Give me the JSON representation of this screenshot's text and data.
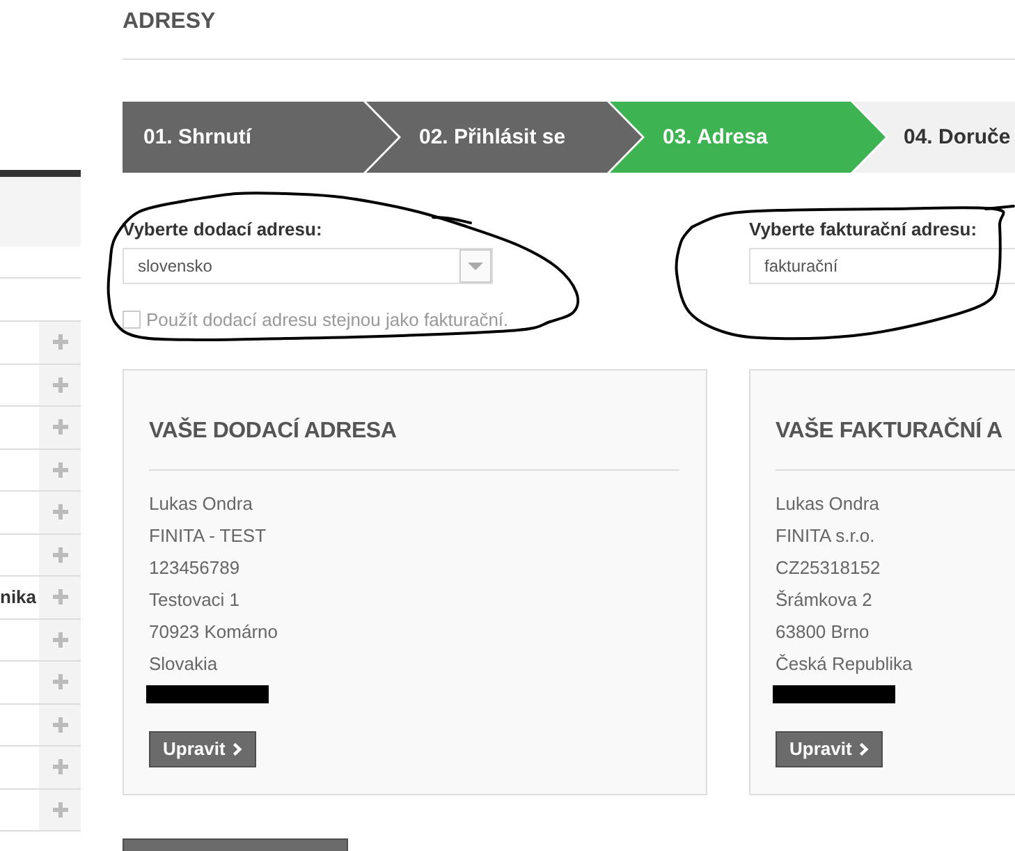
{
  "page": {
    "title": "ADRESY"
  },
  "sidebar": {
    "items": [
      {
        "expanded": false
      },
      {
        "expanded": false
      },
      {
        "expanded": false
      },
      {
        "expanded": false
      },
      {
        "expanded": false
      },
      {
        "expanded": false
      },
      {
        "label": "nika",
        "expanded": false
      },
      {
        "expanded": false
      },
      {
        "expanded": false
      },
      {
        "expanded": false
      },
      {
        "expanded": false
      },
      {
        "expanded": false
      }
    ]
  },
  "steps": [
    {
      "label": "01. Shrnutí",
      "completed": true,
      "selected": false
    },
    {
      "label": "02. Přihlásit se",
      "completed": true,
      "selected": false
    },
    {
      "label": "03. Adresa",
      "completed": false,
      "selected": true
    },
    {
      "label": "04. Doruče",
      "completed": false,
      "selected": false
    }
  ],
  "delivery_select": {
    "label": "Vyberte dodací adresu:",
    "value": "slovensko"
  },
  "same_address_checkbox": {
    "label": "Použít dodací adresu stejnou jako fakturační.",
    "checked": false
  },
  "billing_select": {
    "label": "Vyberte fakturační adresu:",
    "value": "fakturační"
  },
  "address_cards": [
    {
      "title": "VAŠE DODACÍ ADRESA",
      "lines": [
        "Lukas Ondra",
        "FINITA - TEST",
        "123456789",
        "Testovaci 1",
        "70923 Komárno",
        "Slovakia"
      ],
      "redacted": true,
      "button": "Upravit"
    },
    {
      "title": "VAŠE FAKTURAČNÍ A",
      "lines": [
        "Lukas Ondra",
        "FINITA s.r.o.",
        "CZ25318152",
        "Šrámkova 2",
        "63800 Brno",
        "Česká Republika"
      ],
      "redacted": true,
      "button": "Upravit"
    }
  ]
}
